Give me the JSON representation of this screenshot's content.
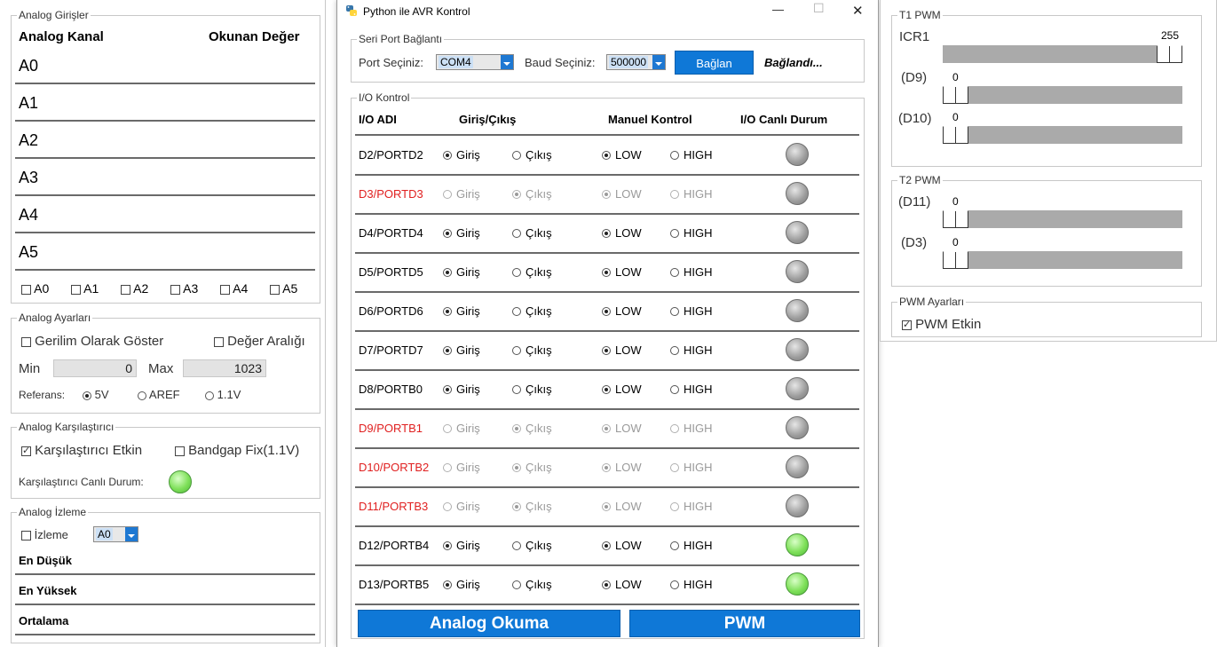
{
  "analog_inputs": {
    "title": "Analog Girişler",
    "col_channel": "Analog Kanal",
    "col_value": "Okunan Değer",
    "channels": [
      "A0",
      "A1",
      "A2",
      "A3",
      "A4",
      "A5"
    ],
    "checkboxes": [
      "A0",
      "A1",
      "A2",
      "A3",
      "A4",
      "A5"
    ]
  },
  "analog_settings": {
    "title": "Analog Ayarları",
    "voltage_label": "Gerilim Olarak Göster",
    "range_label": "Değer Aralığı",
    "min_label": "Min",
    "min_value": "0",
    "max_label": "Max",
    "max_value": "1023",
    "ref_label": "Referans:",
    "ref_options": [
      "5V",
      "AREF",
      "1.1V"
    ]
  },
  "comparator": {
    "title": "Analog Karşılaştırıcı",
    "enable_label": "Karşılaştırıcı Etkin",
    "bandgap_label": "Bandgap Fix(1.1V)",
    "status_label": "Karşılaştırıcı Canlı Durum:"
  },
  "monitor": {
    "title": "Analog İzleme",
    "watch_label": "İzleme",
    "channel_value": "A0",
    "lowest": "En Düşük",
    "highest": "En Yüksek",
    "average": "Ortalama"
  },
  "window": {
    "title": "Python ile AVR Kontrol",
    "minimize": "—",
    "maximize": "☐",
    "close": "✕"
  },
  "serial": {
    "title": "Seri Port Bağlantı",
    "port_label": "Port Seçiniz:",
    "port_value": "COM4",
    "baud_label": "Baud Seçiniz:",
    "baud_value": "500000",
    "connect_button": "Bağlan",
    "status": "Bağlandı..."
  },
  "io": {
    "title": "I/O Kontrol",
    "col_name": "I/O ADI",
    "col_dir": "Giriş/Çıkış",
    "col_manual": "Manuel Kontrol",
    "col_live": "I/O Canlı Durum",
    "input_label": "Giriş",
    "output_label": "Çıkış",
    "low_label": "LOW",
    "high_label": "HIGH",
    "rows": [
      {
        "name": "D2/PORTD2"
      },
      {
        "name": "D3/PORTD3"
      },
      {
        "name": "D4/PORTD4"
      },
      {
        "name": "D5/PORTD5"
      },
      {
        "name": "D6/PORTD6"
      },
      {
        "name": "D7/PORTD7"
      },
      {
        "name": "D8/PORTB0"
      },
      {
        "name": "D9/PORTB1"
      },
      {
        "name": "D10/PORTB2"
      },
      {
        "name": "D11/PORTB3"
      },
      {
        "name": "D12/PORTB4"
      },
      {
        "name": "D13/PORTB5"
      }
    ]
  },
  "bottom_buttons": {
    "analog": "Analog Okuma",
    "pwm": "PWM"
  },
  "t1": {
    "title": "T1 PWM",
    "icr_label": "ICR1",
    "icr_value": "255",
    "d9_label": "(D9)",
    "d9_value": "0",
    "d10_label": "(D10)",
    "d10_value": "0"
  },
  "t2": {
    "title": "T2 PWM",
    "d11_label": "(D11)",
    "d11_value": "0",
    "d3_label": "(D3)",
    "d3_value": "0"
  },
  "pwm_settings": {
    "title": "PWM Ayarları",
    "enable_label": "PWM Etkin"
  },
  "colors": {
    "accent": "#0f78d7",
    "disabled_row": "#e02020",
    "led_on": "#7fe05a",
    "led_off": "#9a9a9a"
  }
}
